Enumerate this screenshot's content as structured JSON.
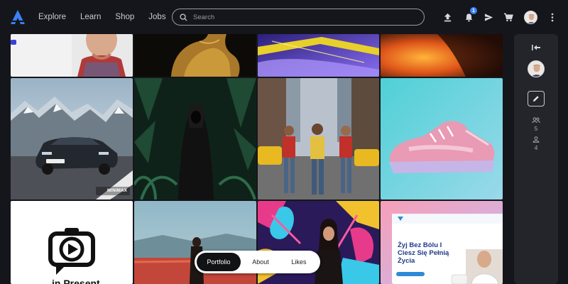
{
  "header": {
    "logo_icon": "triangle-logo-icon",
    "nav": [
      "Explore",
      "Learn",
      "Shop",
      "Jobs"
    ],
    "search_placeholder": "Search",
    "notification_count": "1",
    "icons": [
      "upload-icon",
      "bell-icon",
      "send-icon",
      "cart-icon",
      "avatar",
      "more-vertical-icon"
    ]
  },
  "grid": {
    "tiles": [
      {
        "id": "portrait-man",
        "label": ""
      },
      {
        "id": "golden-figure",
        "label": ""
      },
      {
        "id": "purple-yellow-abstract",
        "label": ""
      },
      {
        "id": "orange-blur",
        "label": ""
      },
      {
        "id": "car-mountains",
        "label": "MINIMAX"
      },
      {
        "id": "hooded-figure-jungle",
        "label": ""
      },
      {
        "id": "street-fashion",
        "label": ""
      },
      {
        "id": "pink-sneaker",
        "label": ""
      },
      {
        "id": "logo-camera",
        "label": "in Present"
      },
      {
        "id": "woman-field",
        "label": ""
      },
      {
        "id": "neon-art-woman",
        "label": ""
      },
      {
        "id": "website-mockup",
        "label": "Żyj Bez Bólu I Ciesz Się Pełnią Życia"
      }
    ]
  },
  "sidepanel": {
    "collapse_icon": "collapse-icon",
    "edit_icon": "pencil-icon",
    "followers_count": "5",
    "following_count": "4"
  },
  "bottom_nav": {
    "tabs": [
      "Portfolio",
      "About",
      "Likes"
    ],
    "active": "Portfolio"
  },
  "colors": {
    "background": "#15161b",
    "panel": "#24252b",
    "accent": "#3b82f6"
  }
}
